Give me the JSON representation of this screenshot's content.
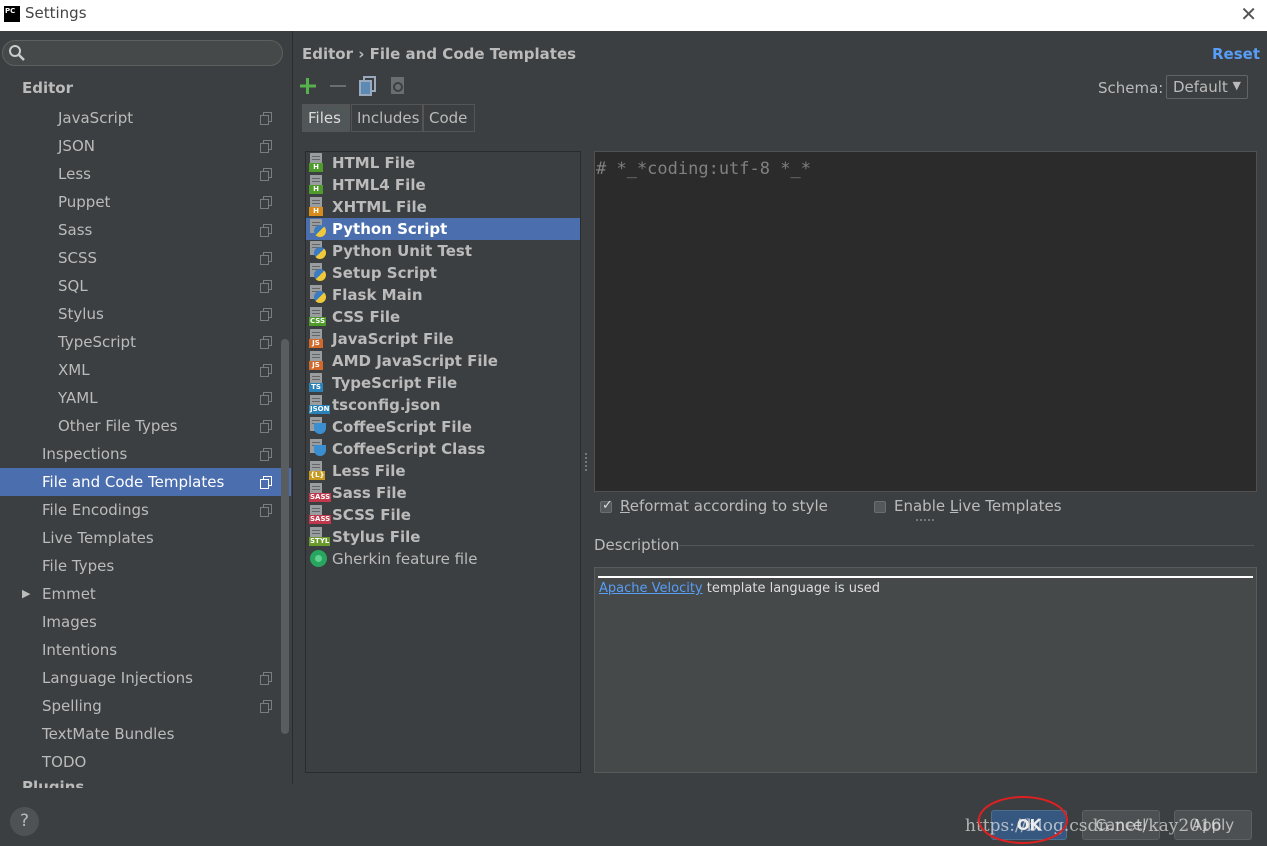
{
  "window": {
    "title": "Settings",
    "logo_text": "PC"
  },
  "sidebar": {
    "search": {
      "placeholder": "",
      "value": ""
    },
    "section_heading": "Editor",
    "items": [
      {
        "label": "JavaScript",
        "level": 2,
        "project_icon": true
      },
      {
        "label": "JSON",
        "level": 2,
        "project_icon": true
      },
      {
        "label": "Less",
        "level": 2,
        "project_icon": true
      },
      {
        "label": "Puppet",
        "level": 2,
        "project_icon": true
      },
      {
        "label": "Sass",
        "level": 2,
        "project_icon": true
      },
      {
        "label": "SCSS",
        "level": 2,
        "project_icon": true
      },
      {
        "label": "SQL",
        "level": 2,
        "project_icon": true
      },
      {
        "label": "Stylus",
        "level": 2,
        "project_icon": true
      },
      {
        "label": "TypeScript",
        "level": 2,
        "project_icon": true
      },
      {
        "label": "XML",
        "level": 2,
        "project_icon": true
      },
      {
        "label": "YAML",
        "level": 2,
        "project_icon": true
      },
      {
        "label": "Other File Types",
        "level": 2,
        "project_icon": true
      },
      {
        "label": "Inspections",
        "level": 1,
        "project_icon": true
      },
      {
        "label": "File and Code Templates",
        "level": 1,
        "project_icon": true,
        "selected": true
      },
      {
        "label": "File Encodings",
        "level": 1,
        "project_icon": true
      },
      {
        "label": "Live Templates",
        "level": 1,
        "project_icon": false
      },
      {
        "label": "File Types",
        "level": 1,
        "project_icon": false
      },
      {
        "label": "Emmet",
        "level": 1,
        "project_icon": false,
        "collapsed": true
      },
      {
        "label": "Images",
        "level": 1,
        "project_icon": false
      },
      {
        "label": "Intentions",
        "level": 1,
        "project_icon": false
      },
      {
        "label": "Language Injections",
        "level": 1,
        "project_icon": true
      },
      {
        "label": "Spelling",
        "level": 1,
        "project_icon": true
      },
      {
        "label": "TextMate Bundles",
        "level": 1,
        "project_icon": false
      },
      {
        "label": "TODO",
        "level": 1,
        "project_icon": false
      }
    ],
    "cutoff_label": "Plugins"
  },
  "main": {
    "breadcrumb": "Editor › File and Code Templates",
    "reset_label": "Reset",
    "toolbar": {
      "add_icon": "plus-icon",
      "remove_icon": "minus-icon",
      "copy_icon": "copy-icon",
      "reset_icon": "reset-template-icon"
    },
    "schema": {
      "label": "Schema:",
      "value": "Default"
    },
    "tabs": [
      {
        "label": "Files",
        "active": true
      },
      {
        "label": "Includes",
        "active": false
      },
      {
        "label": "Code",
        "active": false
      }
    ],
    "templates": [
      {
        "name": "HTML File",
        "badge": "H",
        "badge_color": "#4e9a2b"
      },
      {
        "name": "HTML4 File",
        "badge": "H",
        "badge_color": "#4e9a2b"
      },
      {
        "name": "XHTML File",
        "badge": "H",
        "badge_color": "#d88a1a"
      },
      {
        "name": "Python Script",
        "icon": "python",
        "selected": true
      },
      {
        "name": "Python Unit Test",
        "icon": "python"
      },
      {
        "name": "Setup Script",
        "icon": "python"
      },
      {
        "name": "Flask Main",
        "icon": "python"
      },
      {
        "name": "CSS File",
        "badge": "CSS",
        "badge_color": "#4e9a2b"
      },
      {
        "name": "JavaScript File",
        "badge": "JS",
        "badge_color": "#d2692b"
      },
      {
        "name": "AMD JavaScript File",
        "badge": "JS",
        "badge_color": "#d2692b"
      },
      {
        "name": "TypeScript File",
        "badge": "TS",
        "badge_color": "#2b82b8"
      },
      {
        "name": "tsconfig.json",
        "badge": "JSON",
        "badge_color": "#2b82b8"
      },
      {
        "name": "CoffeeScript File",
        "icon": "coffee"
      },
      {
        "name": "CoffeeScript Class",
        "icon": "coffee"
      },
      {
        "name": "Less File",
        "badge": "{L}",
        "badge_color": "#c89a20"
      },
      {
        "name": "Sass File",
        "badge": "SASS",
        "badge_color": "#c0384b"
      },
      {
        "name": "SCSS File",
        "badge": "SASS",
        "badge_color": "#c0384b"
      },
      {
        "name": "Stylus File",
        "badge": "STYL",
        "badge_color": "#6a9a2b"
      },
      {
        "name": "Gherkin feature file",
        "icon": "gherkin",
        "plain": true
      }
    ],
    "editor_content": "# *_*coding:utf-8 *_*",
    "options": {
      "reformat": {
        "label_pre": "",
        "label_u": "R",
        "label_post": "eformat according to style",
        "checked": true
      },
      "live_templates": {
        "label_pre": "Enable ",
        "label_u": "L",
        "label_post": "ive Templates",
        "checked": false
      }
    },
    "description": {
      "label": "Description",
      "link_text": "Apache Velocity",
      "rest_text": " template language is used"
    }
  },
  "footer": {
    "help_label": "?",
    "ok_label": "OK",
    "cancel_label": "Cancel",
    "apply_label": "Apply",
    "watermark": "https://blog.csdn.net/kay2016"
  },
  "colors": {
    "accent": "#4b6eaf",
    "link": "#589df6",
    "annotation_circle": "#e02020"
  }
}
